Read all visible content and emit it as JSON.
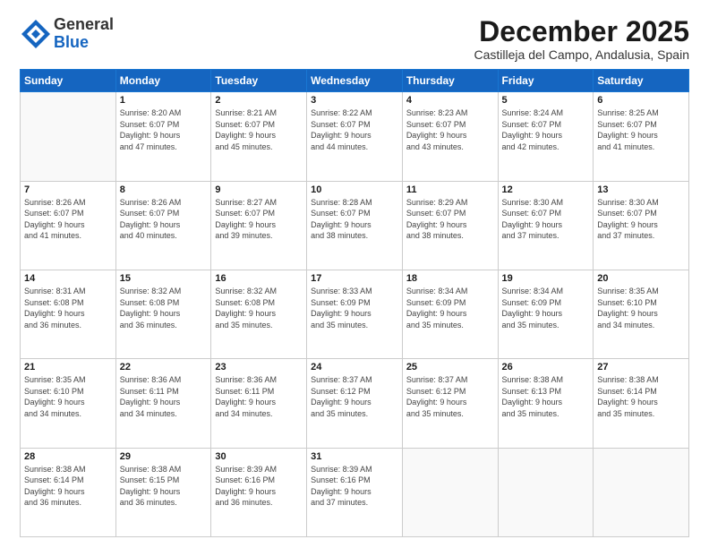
{
  "logo": {
    "general": "General",
    "blue": "Blue"
  },
  "header": {
    "month": "December 2025",
    "location": "Castilleja del Campo, Andalusia, Spain"
  },
  "weekdays": [
    "Sunday",
    "Monday",
    "Tuesday",
    "Wednesday",
    "Thursday",
    "Friday",
    "Saturday"
  ],
  "weeks": [
    [
      {
        "day": "",
        "info": ""
      },
      {
        "day": "1",
        "info": "Sunrise: 8:20 AM\nSunset: 6:07 PM\nDaylight: 9 hours\nand 47 minutes."
      },
      {
        "day": "2",
        "info": "Sunrise: 8:21 AM\nSunset: 6:07 PM\nDaylight: 9 hours\nand 45 minutes."
      },
      {
        "day": "3",
        "info": "Sunrise: 8:22 AM\nSunset: 6:07 PM\nDaylight: 9 hours\nand 44 minutes."
      },
      {
        "day": "4",
        "info": "Sunrise: 8:23 AM\nSunset: 6:07 PM\nDaylight: 9 hours\nand 43 minutes."
      },
      {
        "day": "5",
        "info": "Sunrise: 8:24 AM\nSunset: 6:07 PM\nDaylight: 9 hours\nand 42 minutes."
      },
      {
        "day": "6",
        "info": "Sunrise: 8:25 AM\nSunset: 6:07 PM\nDaylight: 9 hours\nand 41 minutes."
      }
    ],
    [
      {
        "day": "7",
        "info": "Sunrise: 8:26 AM\nSunset: 6:07 PM\nDaylight: 9 hours\nand 41 minutes."
      },
      {
        "day": "8",
        "info": "Sunrise: 8:26 AM\nSunset: 6:07 PM\nDaylight: 9 hours\nand 40 minutes."
      },
      {
        "day": "9",
        "info": "Sunrise: 8:27 AM\nSunset: 6:07 PM\nDaylight: 9 hours\nand 39 minutes."
      },
      {
        "day": "10",
        "info": "Sunrise: 8:28 AM\nSunset: 6:07 PM\nDaylight: 9 hours\nand 38 minutes."
      },
      {
        "day": "11",
        "info": "Sunrise: 8:29 AM\nSunset: 6:07 PM\nDaylight: 9 hours\nand 38 minutes."
      },
      {
        "day": "12",
        "info": "Sunrise: 8:30 AM\nSunset: 6:07 PM\nDaylight: 9 hours\nand 37 minutes."
      },
      {
        "day": "13",
        "info": "Sunrise: 8:30 AM\nSunset: 6:07 PM\nDaylight: 9 hours\nand 37 minutes."
      }
    ],
    [
      {
        "day": "14",
        "info": "Sunrise: 8:31 AM\nSunset: 6:08 PM\nDaylight: 9 hours\nand 36 minutes."
      },
      {
        "day": "15",
        "info": "Sunrise: 8:32 AM\nSunset: 6:08 PM\nDaylight: 9 hours\nand 36 minutes."
      },
      {
        "day": "16",
        "info": "Sunrise: 8:32 AM\nSunset: 6:08 PM\nDaylight: 9 hours\nand 35 minutes."
      },
      {
        "day": "17",
        "info": "Sunrise: 8:33 AM\nSunset: 6:09 PM\nDaylight: 9 hours\nand 35 minutes."
      },
      {
        "day": "18",
        "info": "Sunrise: 8:34 AM\nSunset: 6:09 PM\nDaylight: 9 hours\nand 35 minutes."
      },
      {
        "day": "19",
        "info": "Sunrise: 8:34 AM\nSunset: 6:09 PM\nDaylight: 9 hours\nand 35 minutes."
      },
      {
        "day": "20",
        "info": "Sunrise: 8:35 AM\nSunset: 6:10 PM\nDaylight: 9 hours\nand 34 minutes."
      }
    ],
    [
      {
        "day": "21",
        "info": "Sunrise: 8:35 AM\nSunset: 6:10 PM\nDaylight: 9 hours\nand 34 minutes."
      },
      {
        "day": "22",
        "info": "Sunrise: 8:36 AM\nSunset: 6:11 PM\nDaylight: 9 hours\nand 34 minutes."
      },
      {
        "day": "23",
        "info": "Sunrise: 8:36 AM\nSunset: 6:11 PM\nDaylight: 9 hours\nand 34 minutes."
      },
      {
        "day": "24",
        "info": "Sunrise: 8:37 AM\nSunset: 6:12 PM\nDaylight: 9 hours\nand 35 minutes."
      },
      {
        "day": "25",
        "info": "Sunrise: 8:37 AM\nSunset: 6:12 PM\nDaylight: 9 hours\nand 35 minutes."
      },
      {
        "day": "26",
        "info": "Sunrise: 8:38 AM\nSunset: 6:13 PM\nDaylight: 9 hours\nand 35 minutes."
      },
      {
        "day": "27",
        "info": "Sunrise: 8:38 AM\nSunset: 6:14 PM\nDaylight: 9 hours\nand 35 minutes."
      }
    ],
    [
      {
        "day": "28",
        "info": "Sunrise: 8:38 AM\nSunset: 6:14 PM\nDaylight: 9 hours\nand 36 minutes."
      },
      {
        "day": "29",
        "info": "Sunrise: 8:38 AM\nSunset: 6:15 PM\nDaylight: 9 hours\nand 36 minutes."
      },
      {
        "day": "30",
        "info": "Sunrise: 8:39 AM\nSunset: 6:16 PM\nDaylight: 9 hours\nand 36 minutes."
      },
      {
        "day": "31",
        "info": "Sunrise: 8:39 AM\nSunset: 6:16 PM\nDaylight: 9 hours\nand 37 minutes."
      },
      {
        "day": "",
        "info": ""
      },
      {
        "day": "",
        "info": ""
      },
      {
        "day": "",
        "info": ""
      }
    ]
  ]
}
